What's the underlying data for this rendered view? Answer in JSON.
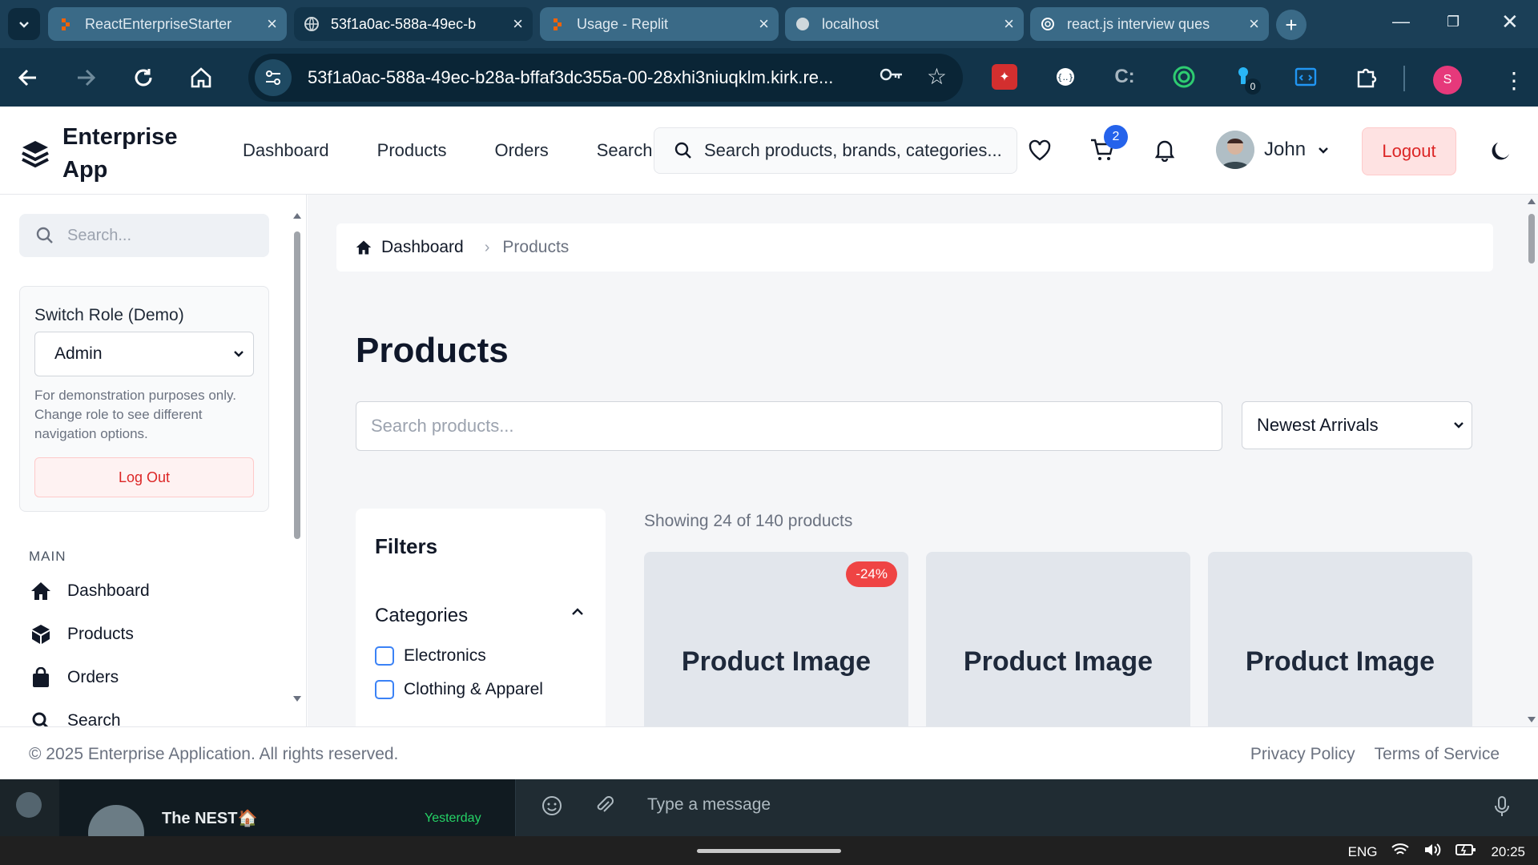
{
  "browser": {
    "tabs": [
      {
        "label": "ReactEnterpriseStarter",
        "icon": "replit-icon"
      },
      {
        "label": "53f1a0ac-588a-49ec-b",
        "icon": "globe-icon"
      },
      {
        "label": "Usage - Replit",
        "icon": "replit-icon"
      },
      {
        "label": "localhost",
        "icon": "globe-icon"
      },
      {
        "label": "react.js interview ques",
        "icon": "openai-icon"
      }
    ],
    "url": "53f1a0ac-588a-49ec-b28a-bffaf3dc355a-00-28xhi3niuqklm.kirk.re...",
    "extension_badge": "0",
    "profile_initial": "S"
  },
  "header": {
    "brand_line1": "Enterprise",
    "brand_line2": "App",
    "nav": [
      "Dashboard",
      "Products",
      "Orders",
      "Search"
    ],
    "search_placeholder": "Search products, brands, categories...",
    "cart_count": "2",
    "user_name": "John",
    "logout_label": "Logout"
  },
  "sidebar": {
    "search_placeholder": "Search...",
    "role_title": "Switch Role (Demo)",
    "role_value": "Admin",
    "role_note": "For demonstration purposes only. Change role to see different navigation options.",
    "logout_label": "Log Out",
    "section_label": "MAIN",
    "items": [
      {
        "label": "Dashboard",
        "icon": "home-icon"
      },
      {
        "label": "Products",
        "icon": "box-icon"
      },
      {
        "label": "Orders",
        "icon": "bag-icon"
      },
      {
        "label": "Search",
        "icon": "search-icon"
      }
    ]
  },
  "main": {
    "breadcrumb_home": "Dashboard",
    "breadcrumb_current": "Products",
    "title": "Products",
    "search_placeholder": "Search products...",
    "sort_value": "Newest Arrivals",
    "filters_title": "Filters",
    "categories_title": "Categories",
    "categories": [
      "Electronics",
      "Clothing & Apparel"
    ],
    "showing_text": "Showing 24 of 140 products",
    "products": [
      {
        "image_label": "Product Image",
        "discount": "-24%"
      },
      {
        "image_label": "Product Image",
        "discount": ""
      },
      {
        "image_label": "Product Image",
        "discount": ""
      }
    ]
  },
  "footer": {
    "copyright": "© 2025 Enterprise Application. All rights reserved.",
    "privacy": "Privacy Policy",
    "terms": "Terms of Service"
  },
  "chat": {
    "group_name": "The NEST🏠",
    "group_time": "Yesterday",
    "message_placeholder": "Type a message"
  },
  "taskbar": {
    "lang": "ENG",
    "time": "20:25"
  }
}
